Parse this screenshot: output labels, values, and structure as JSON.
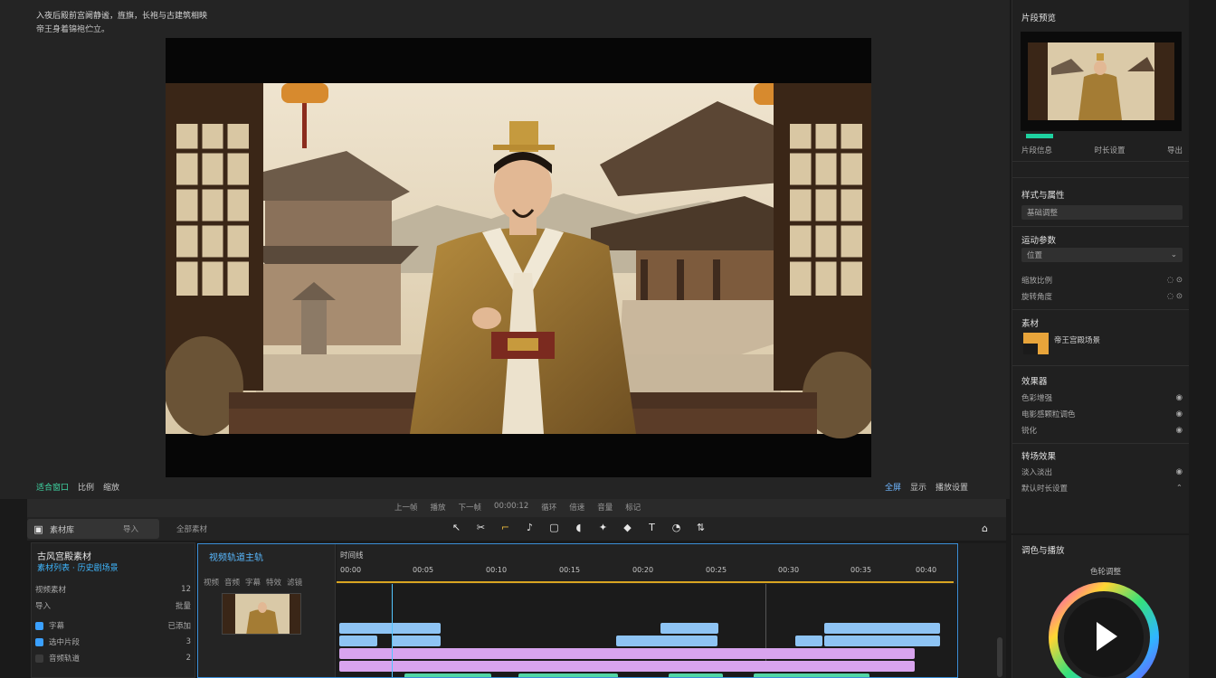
{
  "preview": {
    "caption_line1": "入夜后殿前宫阙静谧，旌旗，长袍与古建筑相映",
    "caption_line2": "帝王身着锦袍伫立。"
  },
  "preview_toolbar": {
    "left": [
      "适合窗口",
      "比例",
      "缩放"
    ],
    "right": [
      "全屏",
      "显示",
      "播放设置"
    ]
  },
  "transport": {
    "items": [
      "上一帧",
      "播放",
      "下一帧",
      "00:00:12",
      "循环",
      "倍速",
      "音量",
      "标记"
    ]
  },
  "tools": {
    "tab_label": "素材库",
    "tab_right": "导入",
    "filter_label": "全部素材",
    "icons": [
      "select-icon",
      "split-icon",
      "crop-icon",
      "music-icon",
      "frame-icon",
      "audio-icon",
      "effect-icon",
      "sticker-icon",
      "text-icon",
      "speed-icon",
      "flip-icon"
    ]
  },
  "media_panel": {
    "title": "古风宫殿素材",
    "subtitle": "素材列表 · 历史剧场景",
    "rows": [
      {
        "label": "视频素材",
        "value": "12"
      },
      {
        "label": "导入",
        "value": "批量"
      },
      {
        "label": "字幕",
        "value": "已添加"
      },
      {
        "label": "选中片段",
        "value": "3"
      },
      {
        "label": "音频轨道",
        "value": "2"
      }
    ]
  },
  "timeline": {
    "track_name": "视频轨道主轨",
    "tabs": [
      "视频",
      "音频",
      "字幕",
      "特效",
      "滤镜"
    ],
    "ruler_labels": [
      "00:00",
      "00:05",
      "00:10",
      "00:15",
      "00:20",
      "00:25",
      "00:30",
      "00:35",
      "00:40"
    ],
    "ruler_header": "时间线"
  },
  "inspector": {
    "preview_title": "片段预览",
    "thumb_left": "片段信息",
    "thumb_mid": "时长设置",
    "thumb_right": "导出",
    "section_style": "样式与属性",
    "style_value": "基础调整",
    "section_motion": "运动参数",
    "motion_field": "位置",
    "rows_motion": [
      "缩放比例",
      "旋转角度"
    ],
    "section_media": "素材",
    "media_name": "帝王宫殿场景",
    "section_fx": "效果器",
    "fx_items": [
      "色彩增强",
      "电影感颗粒调色",
      "锐化"
    ],
    "section_trans": "转场效果",
    "trans_items": [
      "淡入淡出",
      "默认时长设置"
    ]
  },
  "color_panel": {
    "title": "调色与播放",
    "subtitle": "色轮调整"
  },
  "colors": {
    "accent_green": "#1ed2a0",
    "accent_blue": "#3b8fd8",
    "clip_blue": "#8ec4f4",
    "clip_pink": "#d8a4ee",
    "clip_green": "#52d5a4",
    "playline": "#d9a521"
  }
}
